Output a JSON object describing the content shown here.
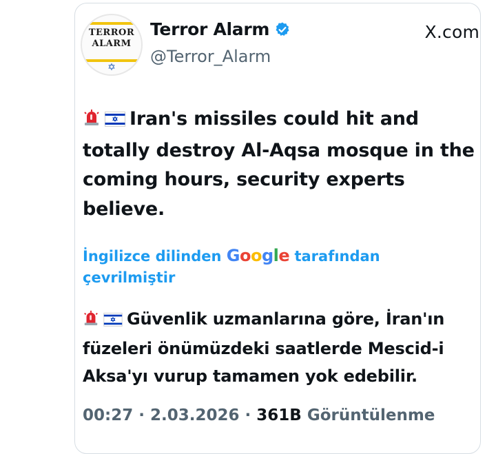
{
  "header": {
    "display_name": "Terror Alarm",
    "handle": "@Terror_Alarm",
    "site": "X.com",
    "avatar_text_line1": "TERROR",
    "avatar_text_line2": "ALARM"
  },
  "post": {
    "text": "Iran's missiles could hit and totally destroy Al-Aqsa mosque in the coming hours, security experts believe.",
    "emojis": [
      "rotating-light-icon",
      "israel-flag-icon"
    ]
  },
  "translation": {
    "prefix": "İngilizce dilinden",
    "brand": "Google",
    "suffix": "tarafından çevrilmiştir",
    "text": "Güvenlik uzmanlarına göre, İran'ın füzeleri önümüzdeki saatlerde Mescid-i Aksa'yı vurup tamamen yok edebilir."
  },
  "meta": {
    "time": "00:27",
    "date": "2.03.2026",
    "views_count": "361B",
    "views_label": "Görüntülenme",
    "separator": "·"
  },
  "colors": {
    "accent": "#1d9bf0",
    "verified": "#1d9bf0",
    "muted": "#536471"
  }
}
